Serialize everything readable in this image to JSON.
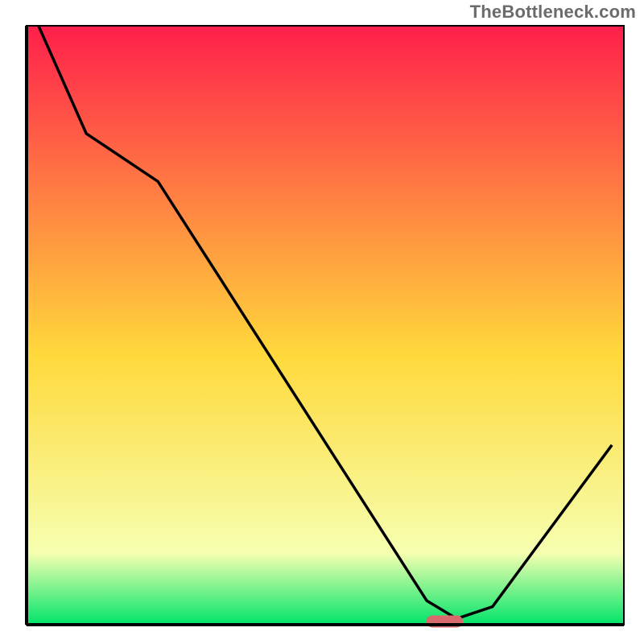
{
  "watermark": "TheBottleneck.com",
  "colors": {
    "gradient_top": "#ff1f4b",
    "gradient_mid": "#ffd93b",
    "gradient_low": "#f6ffb0",
    "gradient_bottom": "#00e46a",
    "frame": "#000000",
    "curve": "#000000",
    "marker_fill": "#d86a6e",
    "marker_stroke": "#d86a6e"
  },
  "chart_data": {
    "type": "line",
    "title": "",
    "xlabel": "",
    "ylabel": "",
    "xlim": [
      0,
      100
    ],
    "ylim": [
      0,
      100
    ],
    "x": [
      2,
      10,
      22,
      67,
      72,
      78,
      98
    ],
    "values": [
      100,
      82,
      74,
      4,
      1,
      3,
      30
    ],
    "optimum_x_range": [
      67,
      73
    ],
    "grid": false,
    "legend": false,
    "notes": "Bottleneck-style curve on a red→green vertical gradient background; pink capsule marks the flat minimum near the bottom. Values are read off relative to the plot frame (0–100 each axis) since no numeric ticks are shown."
  }
}
